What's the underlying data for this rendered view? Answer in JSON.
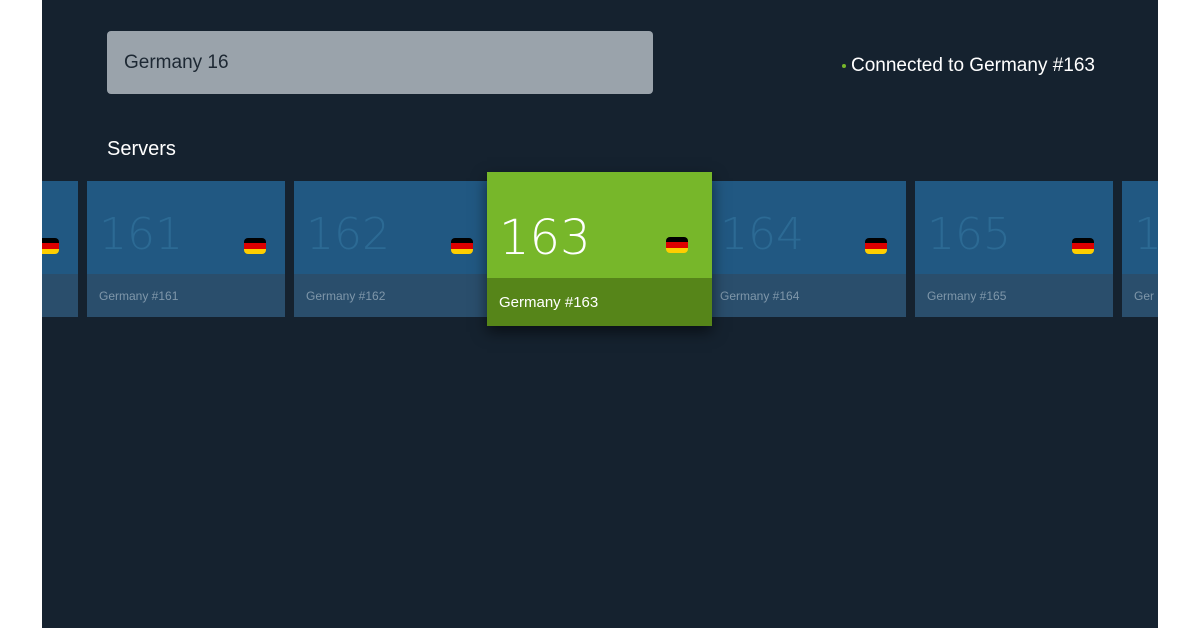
{
  "search": {
    "value": "Germany 16"
  },
  "status": {
    "text": "Connected to Germany #163",
    "dot_color": "#77b72a"
  },
  "servers": {
    "title": "Servers",
    "items": [
      {
        "number": "",
        "name": ""
      },
      {
        "number": "161",
        "name": "Germany #161"
      },
      {
        "number": "162",
        "name": "Germany #162"
      },
      {
        "number": "163",
        "name": "Germany #163",
        "selected": true
      },
      {
        "number": "164",
        "name": "Germany #164"
      },
      {
        "number": "165",
        "name": "Germany #165"
      },
      {
        "number": "1",
        "name": "Ger"
      }
    ],
    "flag_icon": "germany-flag-icon"
  },
  "colors": {
    "background": "#15222f",
    "card": "#215882",
    "card_bar": "#2a4e6c",
    "selected_card": "#77b72a",
    "selected_bar": "#568519",
    "search_box": "#9aa3ab"
  }
}
